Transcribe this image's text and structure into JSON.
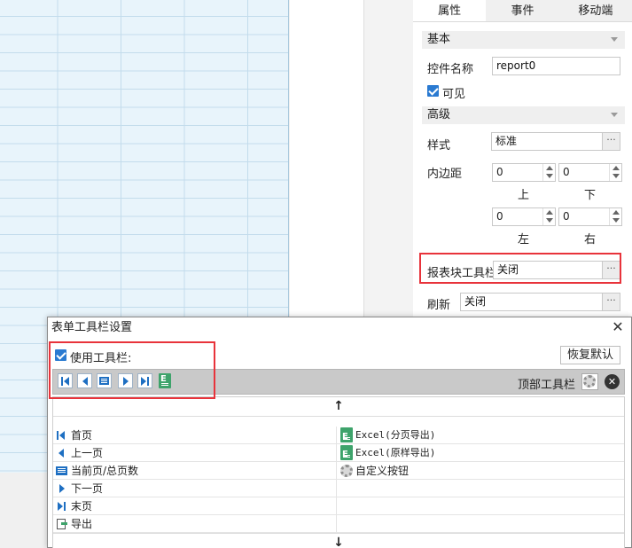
{
  "panel": {
    "tabs": [
      "属性",
      "事件",
      "移动端"
    ],
    "sections": {
      "basic": "基本",
      "advanced": "高级"
    },
    "widget_name_label": "控件名称",
    "widget_name_value": "report0",
    "visible_label": "可见",
    "style_label": "样式",
    "style_value": "标准",
    "padding_label": "内边距",
    "padding": {
      "top": "0",
      "bottom": "0",
      "left": "0",
      "right": "0"
    },
    "padding_caps": {
      "top": "上",
      "bottom": "下",
      "left": "左",
      "right": "右"
    },
    "toolbar_label": "报表块工具栏",
    "toolbar_value": "关闭",
    "refresh_label": "刷新",
    "refresh_value": "关闭",
    "dots": "···"
  },
  "dialog": {
    "title": "表单工具栏设置",
    "use_toolbar_label": "使用工具栏:",
    "restore_default": "恢复默认",
    "top_toolbar_label": "顶部工具栏",
    "up_arrow": "↑",
    "down_arrow": "↓",
    "items_left": [
      "首页",
      "上一页",
      "当前页/总页数",
      "下一页",
      "末页",
      "导出"
    ],
    "items_right": [
      "Excel(分页导出)",
      "Excel(原样导出)",
      "自定义按钮"
    ]
  },
  "colors": {
    "highlight": "#e8333b",
    "accent": "#1e6fc2",
    "checkbox": "#2a7ad1"
  }
}
